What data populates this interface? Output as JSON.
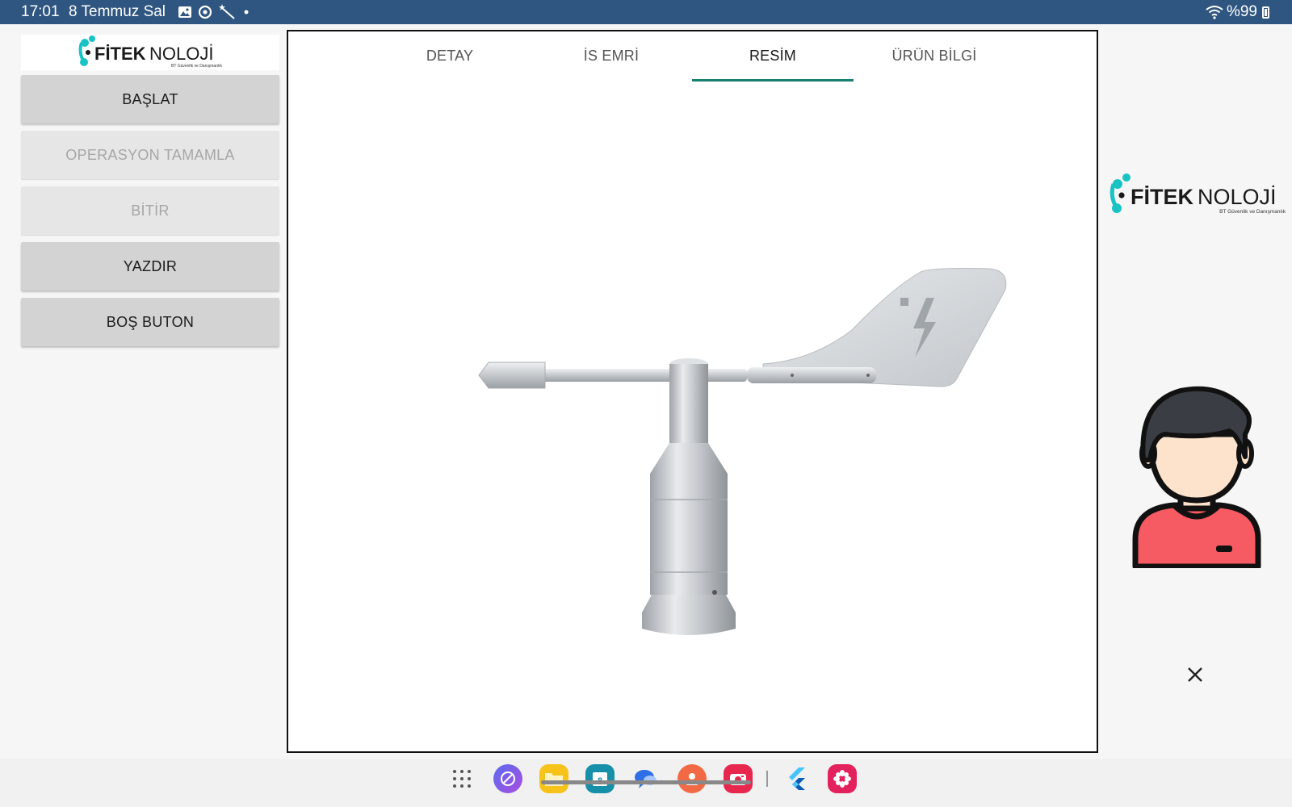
{
  "status_bar": {
    "time": "17:01",
    "date": "8 Temmuz Sal",
    "battery": "%99"
  },
  "brand": {
    "name_bold": "FİTEK",
    "name_light": "NOLOJİ",
    "tagline": "BT Güvenlik ve Danışmanlık",
    "accent": "#19c3c3"
  },
  "sidebar": {
    "buttons": [
      {
        "label": "BAŞLAT",
        "enabled": true
      },
      {
        "label": "OPERASYON TAMAMLA",
        "enabled": false
      },
      {
        "label": "BİTİR",
        "enabled": false
      },
      {
        "label": "YAZDIR",
        "enabled": true
      },
      {
        "label": "BOŞ BUTON",
        "enabled": true
      }
    ]
  },
  "tabs": [
    {
      "label": "DETAY",
      "active": false
    },
    {
      "label": "İS EMRİ",
      "active": false
    },
    {
      "label": "RESİM",
      "active": true
    },
    {
      "label": "ÜRÜN BİLGİ",
      "active": false
    }
  ],
  "colors": {
    "status_bar": "#2f5680",
    "tab_indicator": "#17806f",
    "button_enabled": "#d3d3d3",
    "button_disabled": "#e6e6e6"
  },
  "icons": {
    "product_image": "wind-vane-image",
    "avatar": "user-avatar-icon",
    "close": "close-icon"
  },
  "dock_apps": [
    "apps-grid-icon",
    "browser-icon",
    "files-icon",
    "calendar-icon",
    "messages-icon",
    "contacts-icon",
    "camera-icon",
    "flutter-icon",
    "gallery-icon"
  ],
  "calendar_day": "8"
}
